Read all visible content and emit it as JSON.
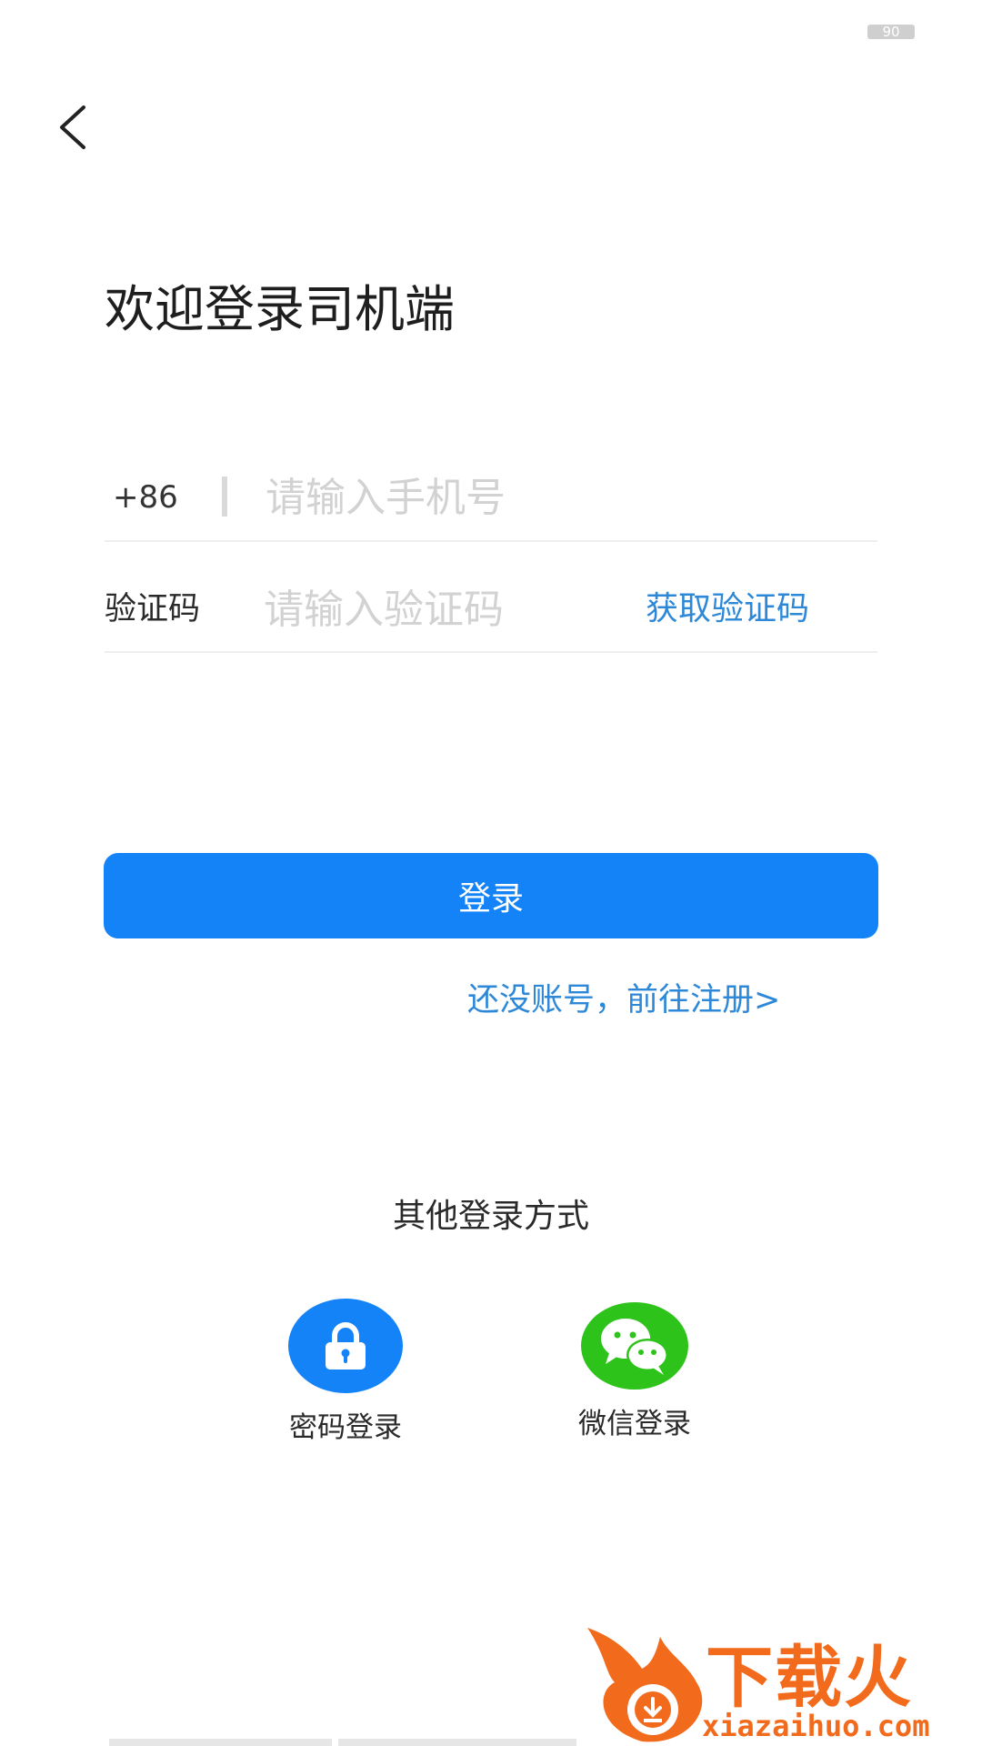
{
  "status_bar": {
    "battery": "90"
  },
  "page": {
    "title": "欢迎登录司机端"
  },
  "phone": {
    "country_code": "+86",
    "placeholder": "请输入手机号"
  },
  "code": {
    "label": "验证码",
    "placeholder": "请输入验证码",
    "get_code_label": "获取验证码"
  },
  "login_button": {
    "label": "登录"
  },
  "register_link": "还没账号，前往注册>",
  "other_login": {
    "title": "其他登录方式",
    "options": [
      {
        "label": "密码登录",
        "icon": "lock-icon"
      },
      {
        "label": "微信登录",
        "icon": "wechat-icon"
      }
    ]
  },
  "watermark": {
    "text": "下载火",
    "domain": "xiazaihuo.com"
  },
  "colors": {
    "primary": "#1483f7",
    "link": "#2d88d8",
    "wechat": "#2dc31a",
    "watermark": "#f26a1b"
  }
}
